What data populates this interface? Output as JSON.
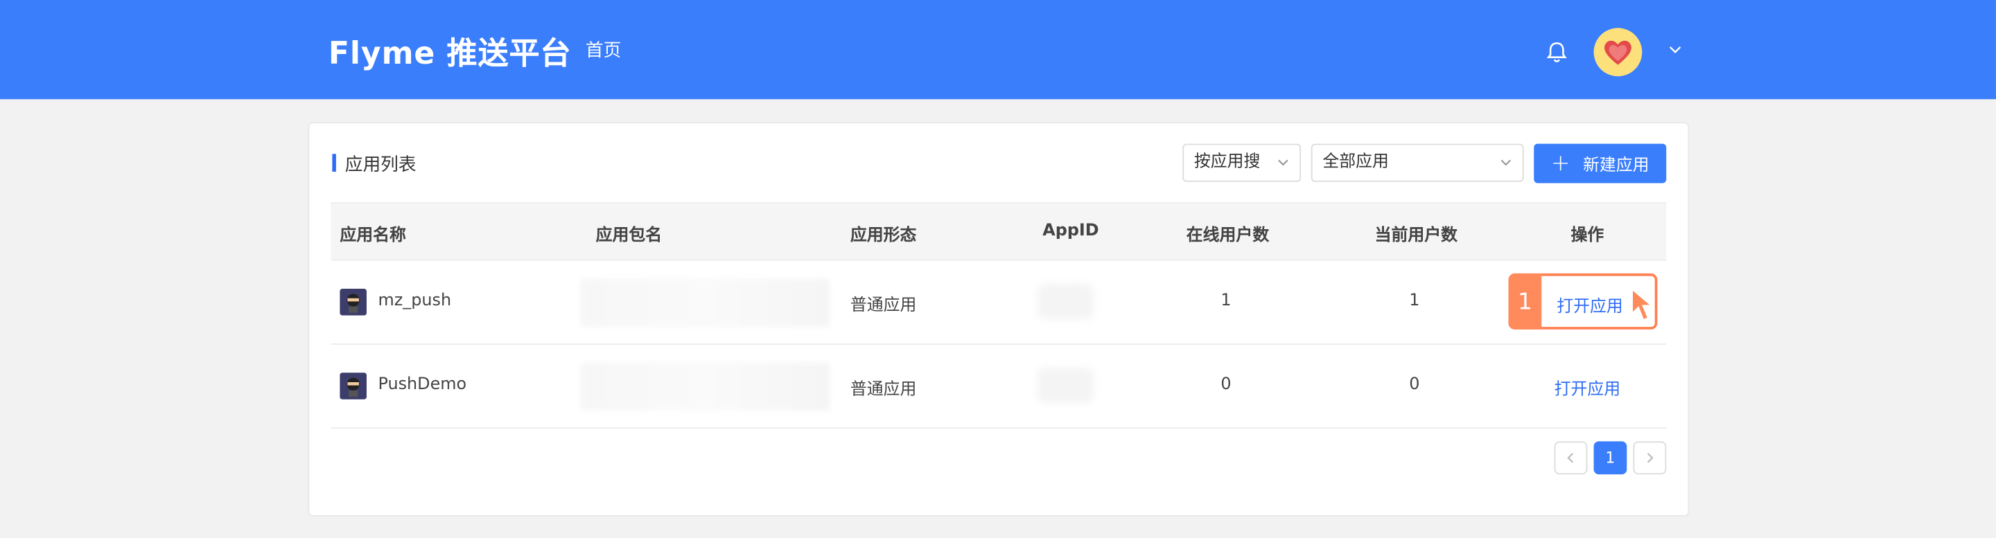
{
  "header": {
    "logo": "Flyme 推送平台",
    "nav_home": "首页"
  },
  "card": {
    "title": "应用列表",
    "search_select": "按应用搜",
    "filter_select": "全部应用",
    "new_button": "新建应用"
  },
  "table": {
    "columns": [
      "应用名称",
      "应用包名",
      "应用形态",
      "AppID",
      "在线用户数",
      "当前用户数",
      "操作"
    ],
    "rows": [
      {
        "name": "mz_push",
        "form": "普通应用",
        "online": "1",
        "current": "1",
        "action": "打开应用"
      },
      {
        "name": "PushDemo",
        "form": "普通应用",
        "online": "0",
        "current": "0",
        "action": "打开应用"
      }
    ]
  },
  "annotation": {
    "step": "1"
  },
  "pagination": {
    "current": "1"
  },
  "colors": {
    "primary": "#3a7efc",
    "highlight": "#ff8a5b",
    "link": "#2f6cf5"
  }
}
